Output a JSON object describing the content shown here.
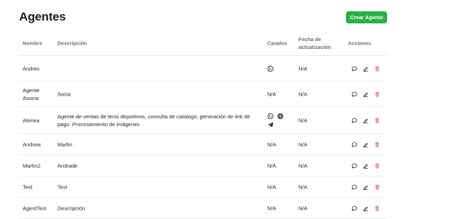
{
  "page": {
    "title": "Agentes",
    "create_button": "Crear Agente"
  },
  "table": {
    "headers": {
      "name": "Nombre",
      "description": "Descripción",
      "channels": "Canales",
      "updated_line1": "Fecha de",
      "updated_line2": "actualización",
      "actions": "Acciones"
    },
    "rows": [
      {
        "name": "Andres",
        "description": "",
        "channels": [
          "whatsapp-icon"
        ],
        "channels_text": "",
        "updated": "N/A"
      },
      {
        "name": "Agente Asocia",
        "description": "Socia",
        "channels": [],
        "channels_text": "N/A",
        "updated": "N/A"
      },
      {
        "name": "Atenea",
        "description": "Agente de ventas de tenis deportivos, consulta de catalogo, generación de link de pago. Procesamiento de imágenes",
        "channels": [
          "whatsapp-icon",
          "globe-icon",
          "telegram-icon"
        ],
        "channels_text": "",
        "updated": "N/A"
      },
      {
        "name": "Andrew",
        "description": "Martin",
        "channels": [],
        "channels_text": "N/A",
        "updated": "N/A"
      },
      {
        "name": "Martin2",
        "description": "Andrade",
        "channels": [],
        "channels_text": "N/A",
        "updated": "N/A"
      },
      {
        "name": "Test",
        "description": "Test",
        "channels": [],
        "channels_text": "N/A",
        "updated": "N/A"
      },
      {
        "name": "AgentTest",
        "description": "Descripción",
        "channels": [],
        "channels_text": "N/A",
        "updated": "N/A"
      }
    ]
  },
  "colors": {
    "primary": "#2bb043",
    "danger": "#e5484d"
  },
  "action_icons": [
    "chat-icon",
    "edit-icon",
    "delete-icon"
  ]
}
